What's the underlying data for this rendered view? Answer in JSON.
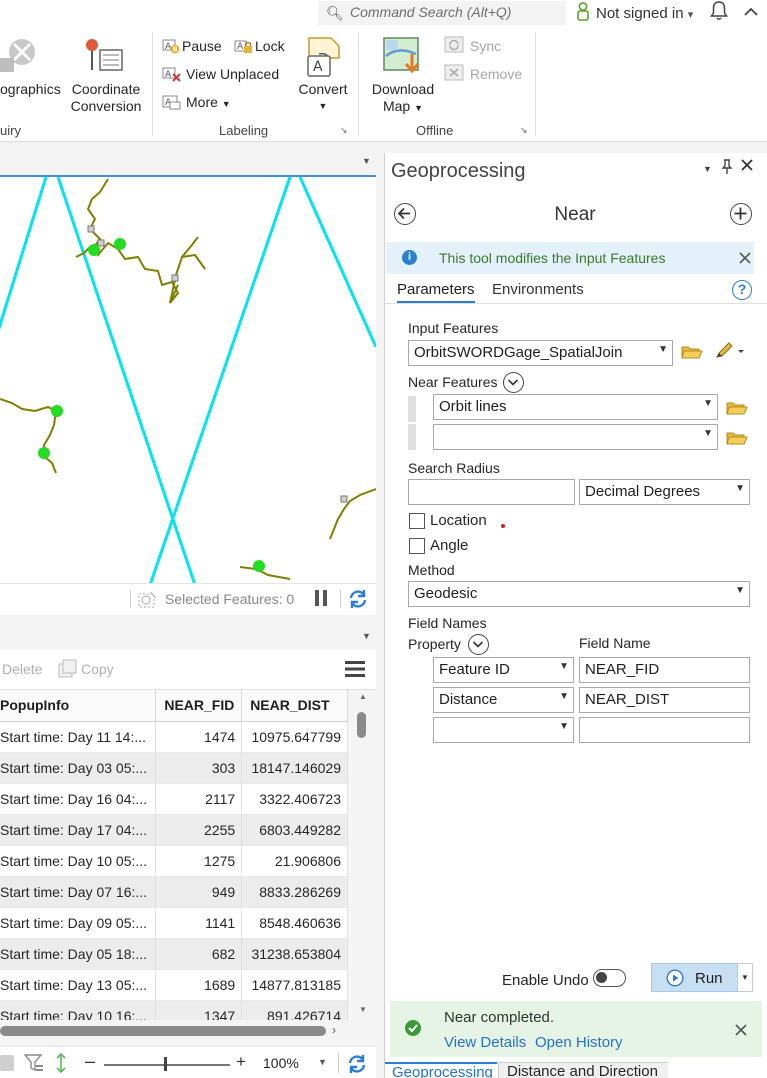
{
  "titlebar": {
    "command_search_placeholder": "Command Search (Alt+Q)",
    "sign_in": "Not signed in",
    "sign_in_caret": "▾"
  },
  "ribbon": {
    "geographics_label": "ographics",
    "inquiry_group": "uiry",
    "coordinate_conversion": [
      "Coordinate",
      "Conversion"
    ],
    "labeling": {
      "pause": "Pause",
      "lock": "Lock",
      "view_unplaced": "View Unplaced",
      "more": "More",
      "convert": "Convert",
      "group_label": "Labeling"
    },
    "offline": {
      "download_map": [
        "Download",
        "Map"
      ],
      "sync": "Sync",
      "remove": "Remove",
      "group_label": "Offline"
    }
  },
  "map": {
    "selected_features": "Selected Features: 0"
  },
  "table": {
    "toolbar": {
      "delete": "Delete",
      "copy": "Copy"
    },
    "columns": [
      "PopupInfo",
      "NEAR_FID",
      "NEAR_DIST"
    ],
    "rows": [
      [
        "Start time: Day 11 14:...",
        "1474",
        "10975.647799"
      ],
      [
        "Start time: Day 03 05:...",
        "303",
        "18147.146029"
      ],
      [
        "Start time: Day 16 04:...",
        "2117",
        "3322.406723"
      ],
      [
        "Start time: Day 17 04:...",
        "2255",
        "6803.449282"
      ],
      [
        "Start time: Day 10 05:...",
        "1275",
        "21.906806"
      ],
      [
        "Start time: Day 07 16:...",
        "949",
        "8833.286269"
      ],
      [
        "Start time: Day 09 05:...",
        "1141",
        "8548.460636"
      ],
      [
        "Start time: Day 05 18:...",
        "682",
        "31238.653804"
      ],
      [
        "Start time: Day 13 05:...",
        "1689",
        "14877.813185"
      ],
      [
        "Start time: Day 10 16:...",
        "1347",
        "891.426714"
      ]
    ],
    "zoom": "100%"
  },
  "gp": {
    "pane_title": "Geoprocessing",
    "tool_title": "Near",
    "info_message": "This tool modifies the Input Features",
    "tabs": {
      "parameters": "Parameters",
      "environments": "Environments"
    },
    "input_features_label": "Input Features",
    "input_features_value": "OrbitSWORDGage_SpatialJoin",
    "near_features_label": "Near Features",
    "near_features_value": "Orbit lines",
    "search_radius_label": "Search Radius",
    "search_radius_value": "",
    "search_radius_unit": "Decimal Degrees",
    "location_label": "Location",
    "angle_label": "Angle",
    "method_label": "Method",
    "method_value": "Geodesic",
    "field_names_label": "Field Names",
    "property_col": "Property",
    "field_name_col": "Field Name",
    "field_rows": [
      {
        "property": "Feature ID",
        "name": "NEAR_FID"
      },
      {
        "property": "Distance",
        "name": "NEAR_DIST"
      },
      {
        "property": "",
        "name": ""
      }
    ],
    "enable_undo": "Enable Undo",
    "run": "Run",
    "status_message": "Near completed.",
    "view_details": "View Details",
    "open_history": "Open History",
    "bottom_tabs": [
      "Geoprocessing",
      "Distance and Direction"
    ]
  },
  "colors": {
    "accent_blue": "#2472c8",
    "orbit_line": "#00e5f0",
    "river": "#808000",
    "gage_point": "#22dd22",
    "info_bg": "#e4f1fb",
    "success_bg": "#e6f4e6"
  }
}
